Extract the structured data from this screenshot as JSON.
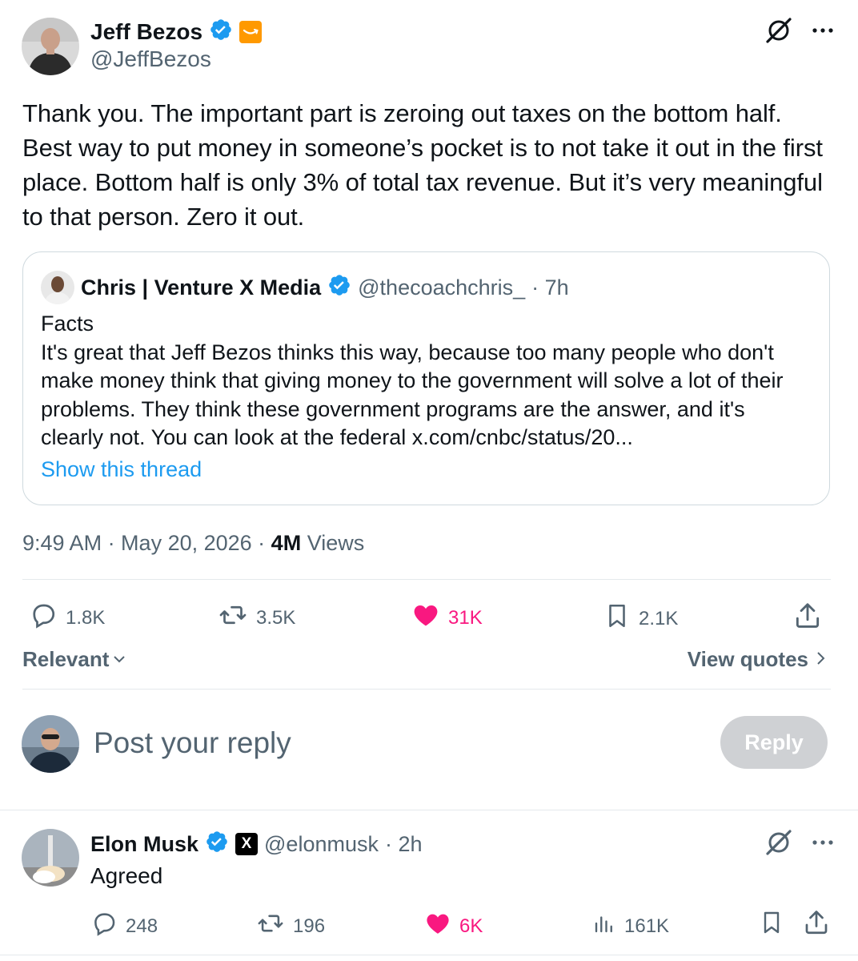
{
  "post": {
    "author_name": "Jeff Bezos",
    "author_handle": "@JeffBezos",
    "text": "Thank you. The important part is zeroing out taxes on the bottom half. Best way to put money in someone’s pocket is to not take it out in the first place. Bottom half is only 3% of total tax revenue. But it’s very meaningful to that person. Zero it out.",
    "timestamp": "9:49 AM · May 20, 2026 · ",
    "views_count": "4M",
    "views_label": " Views",
    "stats": {
      "replies": "1.8K",
      "reposts": "3.5K",
      "likes": "31K",
      "bookmarks": "2.1K"
    }
  },
  "quote": {
    "author_name": "Chris | Venture X Media",
    "author_handle": "@thecoachchris_",
    "time": "· 7h",
    "text_first": "Facts",
    "text_rest": "It's great that Jeff Bezos thinks this way, because too many people who don't make money think that giving money to the government will solve a lot of their problems. They think these government programs are the answer, and it's clearly not. You can look at the federal x.com/cnbc/status/20...",
    "show_thread": "Show this thread"
  },
  "filters": {
    "sort": "Relevant",
    "view_quotes": "View quotes"
  },
  "composer": {
    "placeholder": "Post your reply",
    "button": "Reply"
  },
  "reply": {
    "author_name": "Elon Musk",
    "author_handle": "@elonmusk",
    "time": "· 2h",
    "affiliate_badge": "X",
    "text": "Agreed",
    "stats": {
      "replies": "248",
      "reposts": "196",
      "likes": "6K",
      "views": "161K"
    }
  },
  "colors": {
    "verified_blue": "#1d9bf0",
    "like_pink": "#f91880",
    "secondary_text": "#536471",
    "border": "#cfd9de",
    "reply_button_disabled": "#cfd1d4",
    "amazon_orange": "#ff9900"
  },
  "icons": {
    "grok": "grok-icon",
    "more": "more-icon",
    "reply": "reply-icon",
    "repost": "repost-icon",
    "like": "heart-icon",
    "bookmark": "bookmark-icon",
    "share": "share-icon",
    "views": "analytics-icon",
    "verified": "verified-icon"
  }
}
